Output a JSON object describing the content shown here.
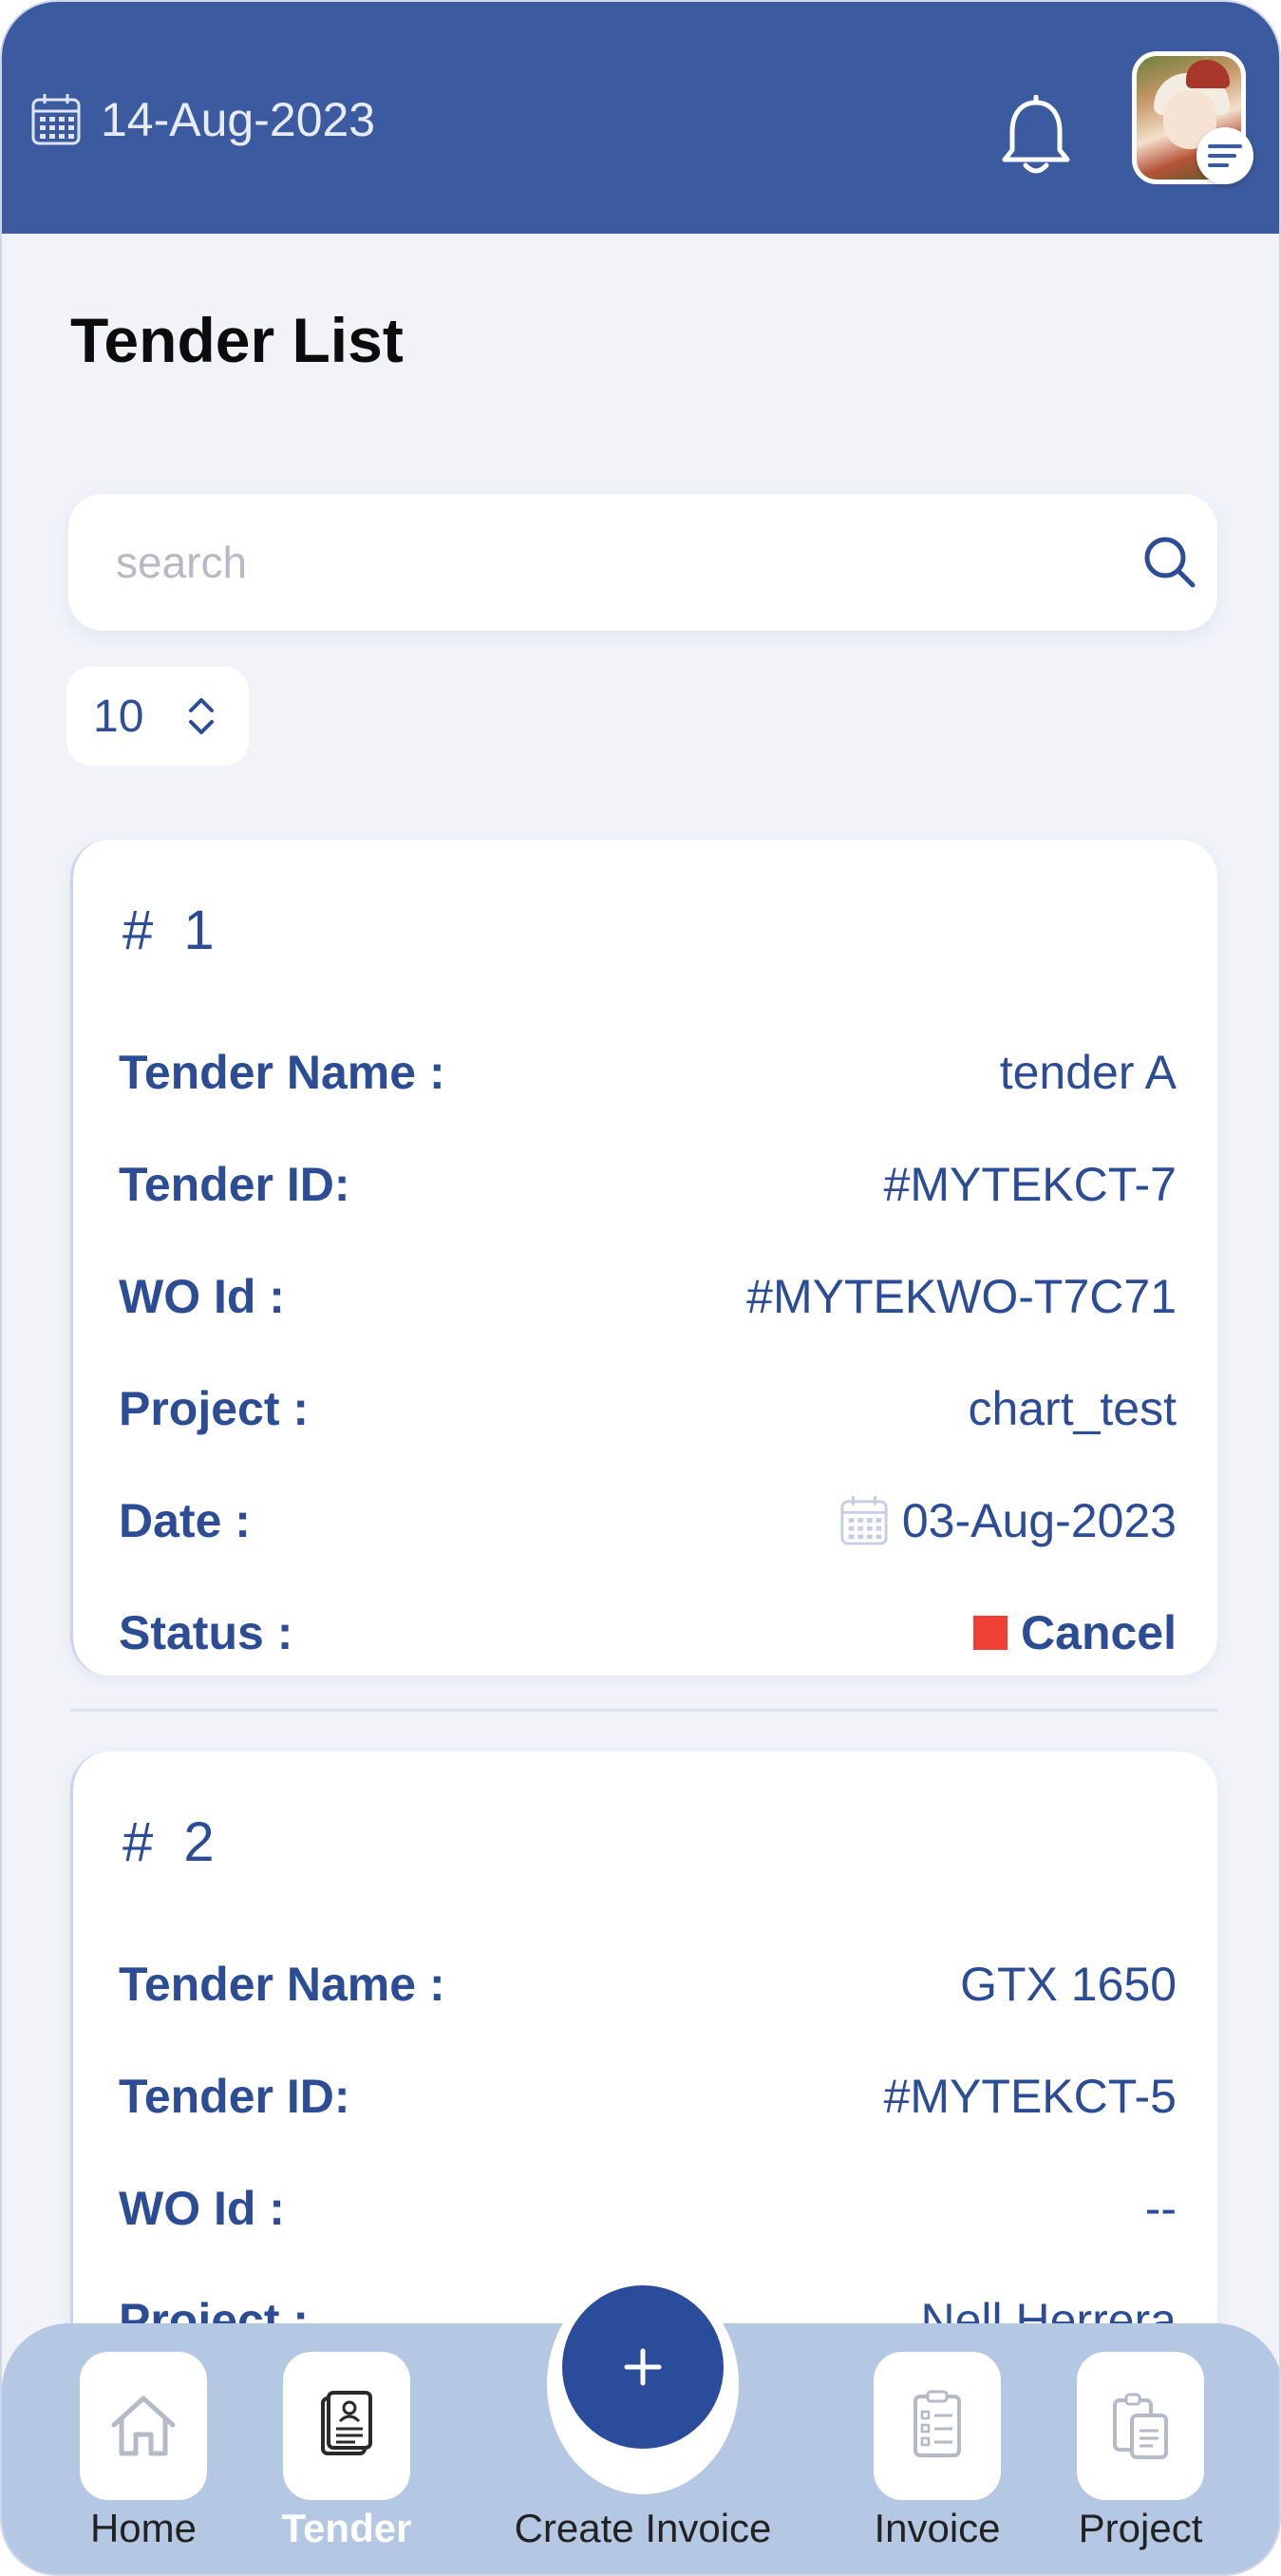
{
  "header": {
    "date": "14-Aug-2023",
    "calendar_icon": "calendar-icon",
    "notification_icon": "bell-icon",
    "menu_icon": "menu-lines-icon",
    "background_color": "#3c5a9f"
  },
  "page": {
    "title": "Tender List"
  },
  "search": {
    "placeholder": "search",
    "value": "",
    "icon": "search-icon"
  },
  "page_size": {
    "value": "10",
    "icon": "chevron-up-down-icon"
  },
  "tenders": [
    {
      "number": "# 1",
      "fields": [
        {
          "label": "Tender Name :",
          "value": "tender A"
        },
        {
          "label": "Tender ID:",
          "value": "#MYTEKCT-7"
        },
        {
          "label": "WO Id :",
          "value": "#MYTEKWO-T7C71"
        },
        {
          "label": "Project :",
          "value": "chart_test"
        },
        {
          "label": "Date :",
          "value": "03-Aug-2023"
        },
        {
          "label": "Status :",
          "value": "Cancel"
        }
      ],
      "status_color": "#ee4035"
    },
    {
      "number": "# 2",
      "fields": [
        {
          "label": "Tender Name :",
          "value": "GTX 1650"
        },
        {
          "label": "Tender ID:",
          "value": "#MYTEKCT-5"
        },
        {
          "label": "WO Id :",
          "value": "--"
        },
        {
          "label": "Project :",
          "value": "Nell Herrera"
        }
      ]
    }
  ],
  "bottom_nav": {
    "items": [
      {
        "label": "Home",
        "icon": "home-icon"
      },
      {
        "label": "Tender",
        "icon": "tender-document-icon",
        "active": true
      },
      {
        "label": "Create Invoice",
        "icon": "plus-icon"
      },
      {
        "label": "Invoice",
        "icon": "clipboard-list-icon"
      },
      {
        "label": "Project",
        "icon": "clipboard-copy-icon"
      }
    ]
  },
  "colors": {
    "accent": "#2c4d96",
    "nav_background": "#b5c8e3",
    "page_background": "#f1f3f9"
  }
}
